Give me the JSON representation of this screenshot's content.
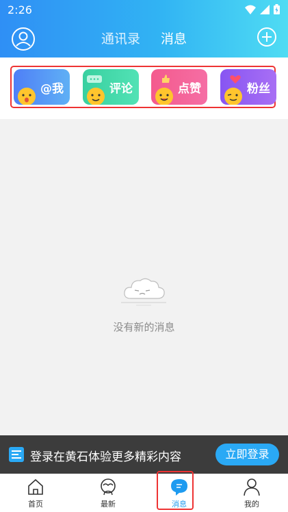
{
  "status_bar": {
    "time": "2:26"
  },
  "header": {
    "tabs": [
      {
        "label": "通讯录",
        "active": false
      },
      {
        "label": "消息",
        "active": true
      }
    ],
    "icons": {
      "left": "avatar-icon",
      "right": "add-icon"
    }
  },
  "categories": [
    {
      "label": "@我",
      "color_from": "#4f7ff7",
      "color_to": "#5fb0f5"
    },
    {
      "label": "评论",
      "color_from": "#38d0a0",
      "color_to": "#52e2b5"
    },
    {
      "label": "点赞",
      "color_from": "#f45a8d",
      "color_to": "#f56ea4"
    },
    {
      "label": "粉丝",
      "color_from": "#8755f2",
      "color_to": "#a86ff4"
    }
  ],
  "empty_state": {
    "text": "没有新的消息",
    "icon": "cloud-face-icon"
  },
  "login_banner": {
    "text": "登录在黄石体验更多精彩内容",
    "button": "立即登录"
  },
  "bottom_nav": [
    {
      "label": "首页",
      "icon": "home-icon",
      "active": false
    },
    {
      "label": "最新",
      "icon": "latest-icon",
      "active": false
    },
    {
      "label": "消息",
      "icon": "message-icon",
      "active": true
    },
    {
      "label": "我的",
      "icon": "profile-icon",
      "active": false
    }
  ],
  "colors": {
    "accent": "#1e9bf0",
    "highlight_frame": "#e33333"
  }
}
